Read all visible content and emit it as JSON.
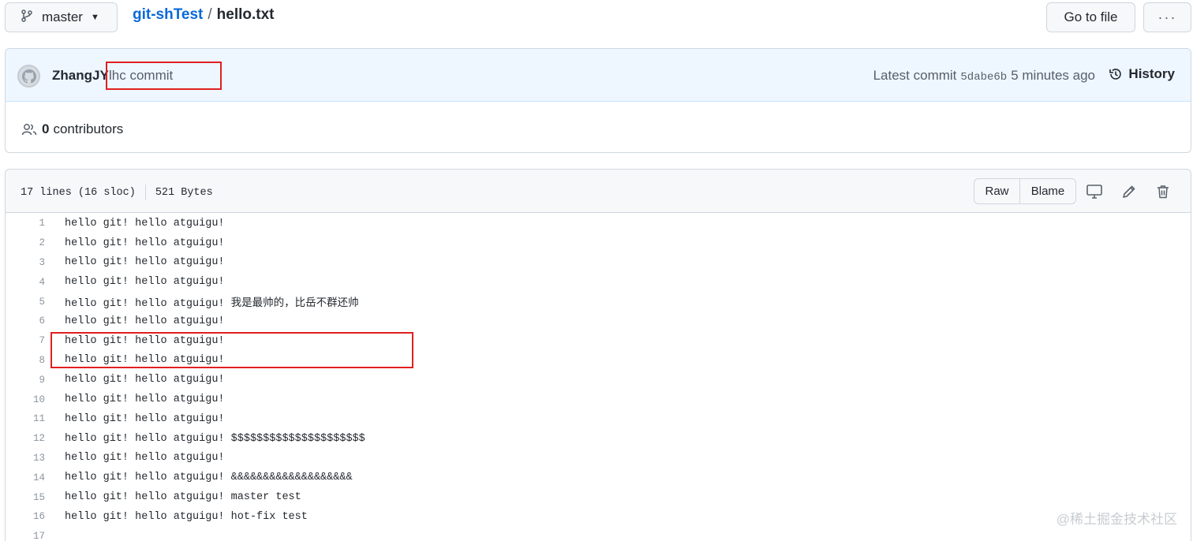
{
  "header": {
    "branch": "master",
    "repo": "git-shTest",
    "separator": "/",
    "file_name": "hello.txt",
    "go_to_file": "Go to file",
    "more": "···"
  },
  "commit": {
    "author": "ZhangJY",
    "message": "lhc commit",
    "latest_label": "Latest commit",
    "sha": "5dabe6b",
    "time": "5 minutes ago",
    "history": "History",
    "contributors_count": "0",
    "contributors_label": "contributors"
  },
  "file": {
    "lines_info": "17 lines (16 sloc)",
    "size": "521 Bytes",
    "raw": "Raw",
    "blame": "Blame",
    "lines": [
      {
        "n": "1",
        "text": "hello git! hello atguigu!"
      },
      {
        "n": "2",
        "text": "hello git! hello atguigu!"
      },
      {
        "n": "3",
        "text": "hello git! hello atguigu!"
      },
      {
        "n": "4",
        "text": "hello git! hello atguigu!"
      },
      {
        "n": "5",
        "text": "hello git! hello atguigu! 我是最帅的，比岳不群还帅"
      },
      {
        "n": "6",
        "text": "hello git! hello atguigu!"
      },
      {
        "n": "7",
        "text": "hello git! hello atguigu!"
      },
      {
        "n": "8",
        "text": "hello git! hello atguigu!"
      },
      {
        "n": "9",
        "text": "hello git! hello atguigu!"
      },
      {
        "n": "10",
        "text": "hello git! hello atguigu!"
      },
      {
        "n": "11",
        "text": "hello git! hello atguigu!"
      },
      {
        "n": "12",
        "text": "hello git! hello atguigu! $$$$$$$$$$$$$$$$$$$$$"
      },
      {
        "n": "13",
        "text": "hello git! hello atguigu!"
      },
      {
        "n": "14",
        "text": "hello git! hello atguigu! &&&&&&&&&&&&&&&&&&&"
      },
      {
        "n": "15",
        "text": "hello git! hello atguigu! master test"
      },
      {
        "n": "16",
        "text": "hello git! hello atguigu! hot-fix test"
      },
      {
        "n": "17",
        "text": ""
      }
    ]
  },
  "watermark": "@稀土掘金技术社区"
}
